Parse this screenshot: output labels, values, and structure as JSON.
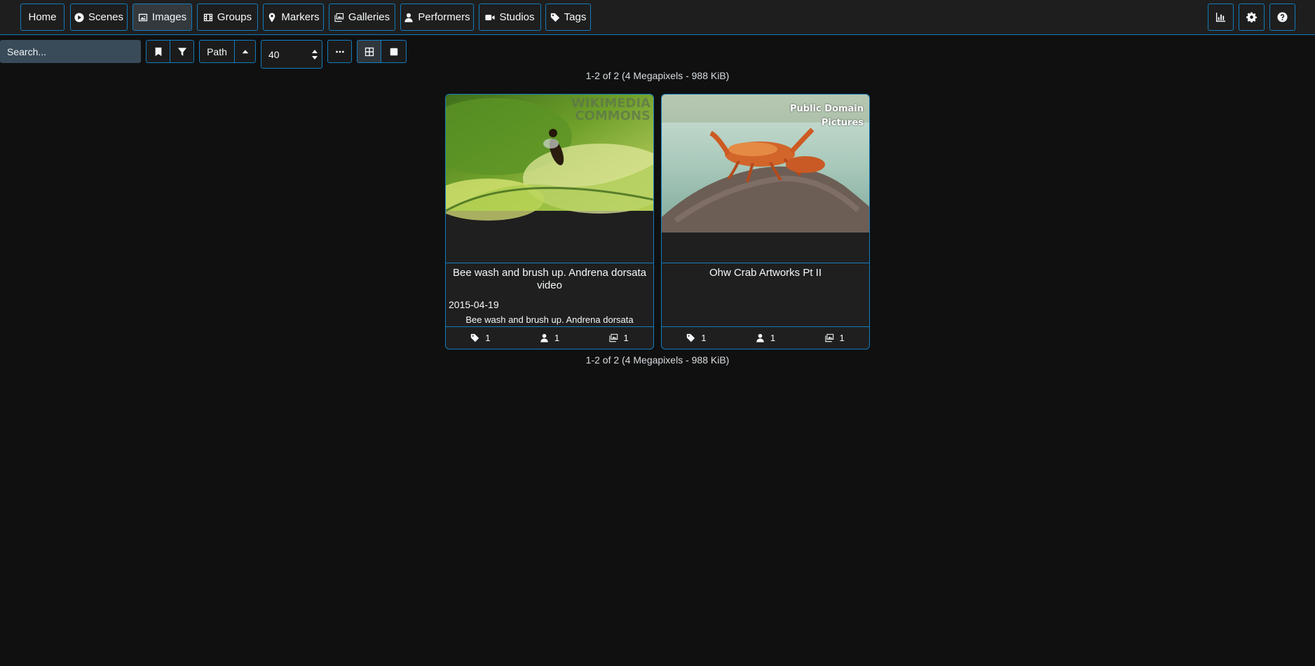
{
  "nav": {
    "home": "Home",
    "scenes": "Scenes",
    "images": "Images",
    "groups": "Groups",
    "markers": "Markers",
    "galleries": "Galleries",
    "performers": "Performers",
    "studios": "Studios",
    "tags": "Tags"
  },
  "toolbar": {
    "search_placeholder": "Search...",
    "sort_by": "Path",
    "per_page": "40"
  },
  "summary": "1-2 of 2 (4 Megapixels - 988 KiB)",
  "cards": [
    {
      "title": "Bee wash and brush up. Andrena dorsata video",
      "date": "2015-04-19",
      "description": "Bee wash and brush up. Andrena dorsata",
      "watermark": "WIKIMEDIA COMMONS",
      "tags": "1",
      "performers": "1",
      "galleries": "1"
    },
    {
      "title": "Ohw Crab Artworks Pt II",
      "date": "",
      "description": "",
      "watermark": "Public Domain Pictures",
      "tags": "1",
      "performers": "1",
      "galleries": "1"
    }
  ],
  "colors": {
    "accent": "#137cbd",
    "background": "#101010",
    "card": "#1f1f1f"
  }
}
